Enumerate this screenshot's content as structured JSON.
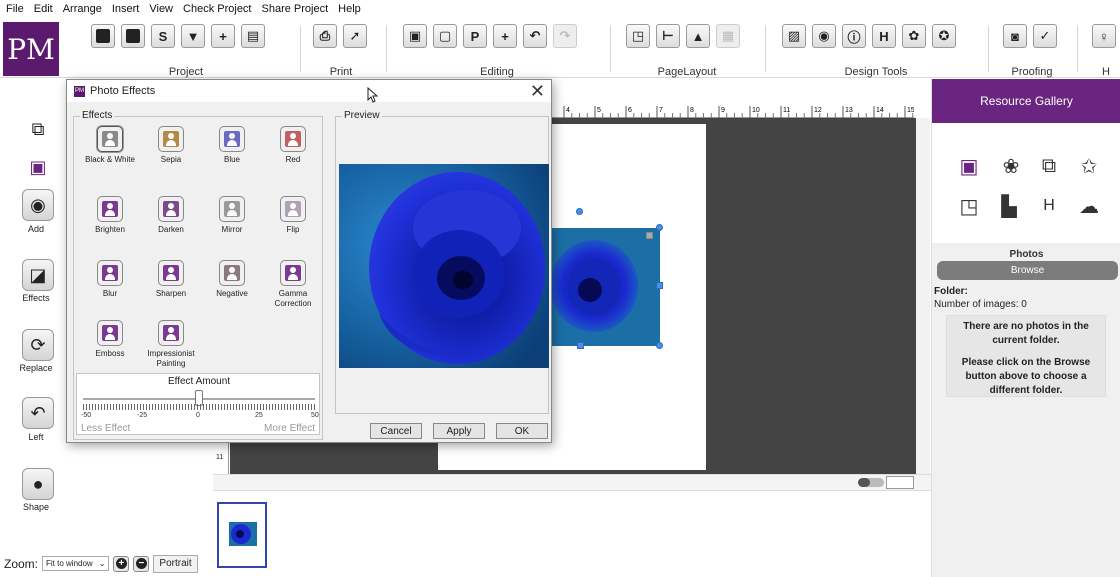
{
  "menu": [
    "File",
    "Edit",
    "Arrange",
    "Insert",
    "View",
    "Check Project",
    "Share Project",
    "Help"
  ],
  "logo": "PM",
  "ribbon": {
    "groups": [
      {
        "label": "Project",
        "icons": [
          "new-project-icon",
          "open-folder-icon",
          "save-icon",
          "save-as-icon",
          "add-page-icon",
          "document-icon"
        ]
      },
      {
        "label": "Print",
        "icons": [
          "print-icon",
          "export-icon"
        ]
      },
      {
        "label": "Editing",
        "icons": [
          "paste-icon",
          "copy-icon",
          "text-p-icon",
          "add-icon",
          "undo-icon",
          "redo-icon"
        ]
      },
      {
        "label": "PageLayout",
        "icons": [
          "layout-icon",
          "guides-icon",
          "align-icon",
          "grid-icon"
        ]
      },
      {
        "label": "Design Tools",
        "icons": [
          "image-icon",
          "camera-icon",
          "info-icon",
          "heading-icon",
          "flower-icon",
          "badge-icon"
        ]
      },
      {
        "label": "Proofing",
        "icons": [
          "proof-icon",
          "spellcheck-icon"
        ]
      },
      {
        "label": "H",
        "icons": [
          "lightbulb-icon"
        ]
      }
    ]
  },
  "left_tools": [
    {
      "label": "",
      "icon": "layers-icon"
    },
    {
      "label": "",
      "icon": "photo-frame-icon"
    },
    {
      "label": "Add",
      "icon": "camera-icon"
    },
    {
      "label": "Effects",
      "icon": "effects-icon"
    },
    {
      "label": "Replace",
      "icon": "replace-icon"
    },
    {
      "label": "Left",
      "icon": "rotate-left-icon"
    },
    {
      "label": "Shape",
      "icon": "shape-icon"
    }
  ],
  "zoom": {
    "label": "Zoom:",
    "value": "Fit to window",
    "orientation": "Portrait"
  },
  "ruler_numbers": [
    "4",
    "5",
    "6",
    "7",
    "8",
    "9",
    "10",
    "11",
    "12",
    "13",
    "14",
    "15"
  ],
  "ruler_left_number": "11",
  "resource_gallery": {
    "title": "Resource Gallery",
    "icons": [
      "photos-icon",
      "lotus-icon",
      "shapes-icon",
      "star-outline-icon",
      "frames-icon",
      "layouts-icon",
      "heading-icon",
      "dotcom-icon"
    ],
    "section": "Photos",
    "browse": "Browse",
    "folder_label": "Folder:",
    "count_label": "Number of images: 0",
    "message_1": "There are no photos in the current folder.",
    "message_2": "Please click on the Browse button above to choose a different folder."
  },
  "dialog": {
    "title": "Photo Effects",
    "effects_legend": "Effects",
    "preview_legend": "Preview",
    "effects": [
      {
        "label": "Black & White",
        "color": "#8a8a8a"
      },
      {
        "label": "Sepia",
        "color": "#b48a4a"
      },
      {
        "label": "Blue",
        "color": "#6a6ac0"
      },
      {
        "label": "Red",
        "color": "#c06060"
      },
      {
        "label": "Brighten",
        "color": "#7a3a90"
      },
      {
        "label": "Darken",
        "color": "#7a4a8a"
      },
      {
        "label": "Mirror",
        "color": "#9a9a9a"
      },
      {
        "label": "Flip",
        "color": "#b0a0b8"
      },
      {
        "label": "Blur",
        "color": "#7a3a90"
      },
      {
        "label": "Sharpen",
        "color": "#7a3a90"
      },
      {
        "label": "Negative",
        "color": "#8a7a80"
      },
      {
        "label": "Gamma Correction",
        "color": "#7a3a90"
      },
      {
        "label": "Emboss",
        "color": "#7a3a90"
      },
      {
        "label": "Impressionist Painting",
        "color": "#7a3a90"
      }
    ],
    "amount": {
      "title": "Effect Amount",
      "min": -50,
      "max": 50,
      "value": 0,
      "tick_labels": [
        "-50",
        "-25",
        "0",
        "25",
        "50"
      ],
      "less": "Less Effect",
      "more": "More Effect"
    },
    "buttons": {
      "cancel": "Cancel",
      "apply": "Apply",
      "ok": "OK"
    },
    "close": "✕"
  },
  "colors": {
    "brand": "#5b1a6e",
    "gallery_header": "#6a2580",
    "rose": "#1a2ad0"
  }
}
